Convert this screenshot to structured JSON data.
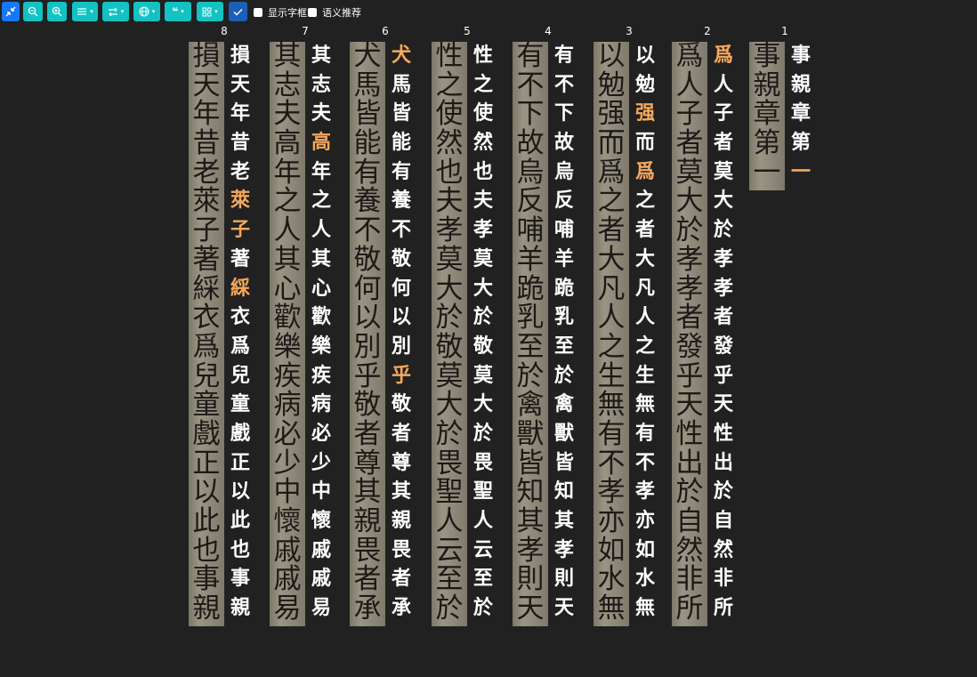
{
  "toolbar": {
    "buttons": [
      {
        "name": "collapse-button",
        "icon": "collapse-arrows-icon"
      },
      {
        "name": "zoom-out-button",
        "icon": "zoom-out-icon"
      },
      {
        "name": "zoom-in-button",
        "icon": "zoom-in-icon"
      },
      {
        "name": "layout-menu-button",
        "icon": "list-lines-icon"
      },
      {
        "name": "direction-menu-button",
        "icon": "swap-arrows-icon"
      },
      {
        "name": "language-menu-button",
        "icon": "globe-icon"
      },
      {
        "name": "punctuation-menu-button",
        "icon": "quote-icon"
      },
      {
        "name": "view-menu-button",
        "icon": "grid-icon"
      },
      {
        "name": "confirm-button",
        "icon": "check-icon"
      }
    ],
    "show_char_box_label": "显示字框",
    "semantic_recommend_label": "语义推荐",
    "colors": {
      "accent": "#13c2c2",
      "primary": "#1677ff",
      "highlight": "#f5a85c"
    }
  },
  "columns": [
    {
      "number": "1",
      "scan": "事親章第一",
      "text": "事親章第一",
      "highlight": [
        4
      ]
    },
    {
      "number": "2",
      "scan": "爲人子者莫大於孝孝者發乎天性出於自然非所",
      "text": "爲人子者莫大於孝孝者發乎天性出於自然非所",
      "highlight": [
        0
      ]
    },
    {
      "number": "3",
      "scan": "以勉强而爲之者大凡人之生無有不孝亦如水無",
      "text": "以勉强而爲之者大凡人之生無有不孝亦如水無",
      "highlight": [
        2,
        4
      ]
    },
    {
      "number": "4",
      "scan": "有不下故烏反哺羊跪乳至於禽獸皆知其孝則天",
      "text": "有不下故烏反哺羊跪乳至於禽獸皆知其孝則天",
      "highlight": []
    },
    {
      "number": "5",
      "scan": "性之使然也夫孝莫大於敬莫大於畏聖人云至於",
      "text": "性之使然也夫孝莫大於敬莫大於畏聖人云至於",
      "highlight": []
    },
    {
      "number": "6",
      "scan": "犬馬皆能有養不敬何以別乎敬者尊其親畏者承",
      "text": "犬馬皆能有養不敬何以別乎敬者尊其親畏者承",
      "highlight": [
        0,
        11
      ]
    },
    {
      "number": "7",
      "scan": "其志夫高年之人其心歡樂疾病必少中懷戚戚易",
      "text": "其志夫高年之人其心歡樂疾病必少中懷戚戚易",
      "highlight": [
        3
      ]
    },
    {
      "number": "8",
      "scan": "損天年昔老萊子著綵衣爲兒童戲正以此也事親",
      "text": "損天年昔老萊子著綵衣爲兒童戲正以此也事親",
      "highlight": [
        5,
        6,
        8
      ]
    }
  ]
}
